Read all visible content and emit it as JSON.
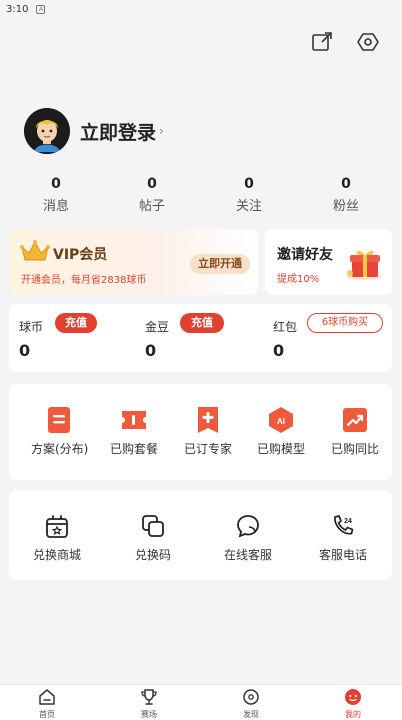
{
  "status": {
    "time": "3:10",
    "sim_label": "A"
  },
  "profile": {
    "login_label": "立即登录",
    "arrow": "›"
  },
  "stats": [
    {
      "value": "0",
      "label": "消息"
    },
    {
      "value": "0",
      "label": "帖子"
    },
    {
      "value": "0",
      "label": "关注"
    },
    {
      "value": "0",
      "label": "粉丝"
    }
  ],
  "vip": {
    "title": "VIP会员",
    "subtitle": "开通会员，每月省2838球币",
    "button": "立即开通"
  },
  "invite": {
    "title": "邀请好友",
    "subtitle": "提成10%"
  },
  "wallet": {
    "coins": {
      "label": "球币",
      "value": "0",
      "action": "充值"
    },
    "beans": {
      "label": "金豆",
      "value": "0",
      "action": "充值"
    },
    "redpack": {
      "label": "红包",
      "value": "0",
      "action": "6球币购买"
    }
  },
  "services": [
    {
      "label": "方案(分布)",
      "icon": "document-icon"
    },
    {
      "label": "已购套餐",
      "icon": "ticket-icon"
    },
    {
      "label": "已订专家",
      "icon": "expert-icon"
    },
    {
      "label": "已购模型",
      "icon": "ai-icon"
    },
    {
      "label": "已购同比",
      "icon": "trend-icon"
    }
  ],
  "tools": [
    {
      "label": "兑换商城",
      "icon": "store-icon"
    },
    {
      "label": "兑换码",
      "icon": "code-icon"
    },
    {
      "label": "在线客服",
      "icon": "chat-icon"
    },
    {
      "label": "客服电话",
      "icon": "phone-icon"
    }
  ],
  "tabs": [
    {
      "label": "首页",
      "icon": "home-icon",
      "active": false
    },
    {
      "label": "赛场",
      "icon": "trophy-icon",
      "active": false
    },
    {
      "label": "发现",
      "icon": "discover-icon",
      "active": false
    },
    {
      "label": "我的",
      "icon": "profile-icon",
      "active": true
    }
  ],
  "colors": {
    "accent": "#e1412f",
    "background": "#f4f4f6",
    "vip_text": "#6b3c12"
  }
}
